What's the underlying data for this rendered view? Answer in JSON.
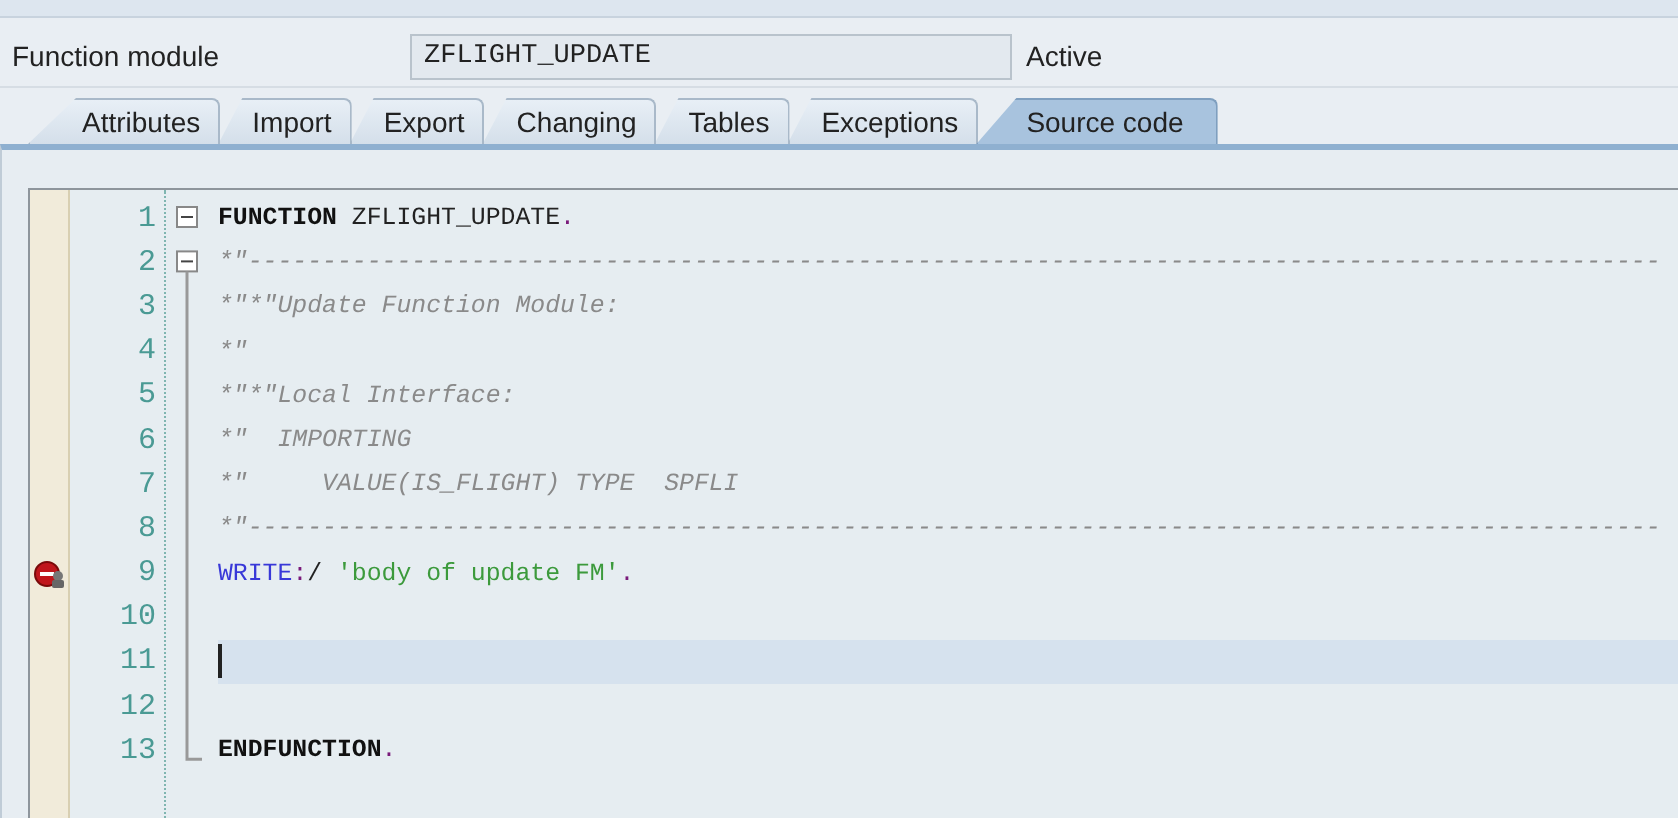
{
  "header": {
    "label": "Function module",
    "value": "ZFLIGHT_UPDATE",
    "status": "Active"
  },
  "tabs": [
    {
      "label": "Attributes",
      "selected": false
    },
    {
      "label": "Import",
      "selected": false
    },
    {
      "label": "Export",
      "selected": false
    },
    {
      "label": "Changing",
      "selected": false
    },
    {
      "label": "Tables",
      "selected": false
    },
    {
      "label": "Exceptions",
      "selected": false
    },
    {
      "label": "Source code",
      "selected": true
    }
  ],
  "editor": {
    "lines": [
      {
        "number": "1",
        "tokens": [
          {
            "text": "FUNCTION",
            "kind": "keyword"
          },
          {
            "text": " ZFLIGHT_UPDATE",
            "kind": "plain"
          },
          {
            "text": ".",
            "kind": "punct"
          }
        ]
      },
      {
        "number": "2",
        "tokens": [
          {
            "text": "*\"-----------------------------------------------------------------------------------------------",
            "kind": "comment"
          }
        ]
      },
      {
        "number": "3",
        "tokens": [
          {
            "text": "*\"*\"Update Function Module:",
            "kind": "comment"
          }
        ]
      },
      {
        "number": "4",
        "tokens": [
          {
            "text": "*\"",
            "kind": "comment"
          }
        ]
      },
      {
        "number": "5",
        "tokens": [
          {
            "text": "*\"*\"Local Interface:",
            "kind": "comment"
          }
        ]
      },
      {
        "number": "6",
        "tokens": [
          {
            "text": "*\"  IMPORTING",
            "kind": "comment"
          }
        ]
      },
      {
        "number": "7",
        "tokens": [
          {
            "text": "*\"     VALUE(IS_FLIGHT) TYPE  SPFLI",
            "kind": "comment"
          }
        ]
      },
      {
        "number": "8",
        "tokens": [
          {
            "text": "*\"-----------------------------------------------------------------------------------------------",
            "kind": "comment"
          }
        ]
      },
      {
        "number": "9",
        "breakpoint": true,
        "tokens": [
          {
            "text": "WRITE",
            "kind": "statement"
          },
          {
            "text": ":",
            "kind": "punct"
          },
          {
            "text": "/ ",
            "kind": "plain"
          },
          {
            "text": "'body of update FM'",
            "kind": "string"
          },
          {
            "text": ".",
            "kind": "punct"
          }
        ]
      },
      {
        "number": "10"
      },
      {
        "number": "11",
        "current": true
      },
      {
        "number": "12"
      },
      {
        "number": "13",
        "tokens": [
          {
            "text": "ENDFUNCTION",
            "kind": "keyword"
          },
          {
            "text": ".",
            "kind": "punct"
          }
        ]
      }
    ]
  }
}
